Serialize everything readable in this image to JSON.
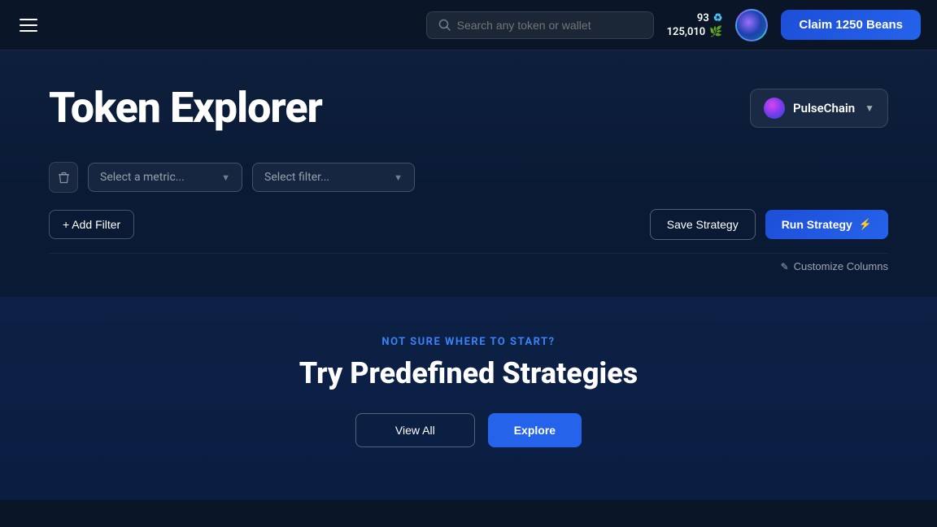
{
  "header": {
    "menu_label": "Menu",
    "search_placeholder": "Search any token or wallet",
    "stats": {
      "count": "93",
      "points": "125,010"
    },
    "claim_button_label": "Claim 1250 Beans"
  },
  "page": {
    "title": "Token Explorer",
    "chain_selector": {
      "name": "PulseChain",
      "arrow": "▼"
    },
    "filter": {
      "metric_placeholder": "Select a metric...",
      "filter_placeholder": "Select filter..."
    },
    "buttons": {
      "add_filter": "+ Add Filter",
      "save_strategy": "Save Strategy",
      "run_strategy": "Run Strategy",
      "customize_columns": "Customize Columns"
    }
  },
  "bottom": {
    "subtitle": "NOT SURE WHERE TO START?",
    "title": "Try Predefined Strategies",
    "btn_outline": "View All",
    "btn_filled": "Explore"
  }
}
